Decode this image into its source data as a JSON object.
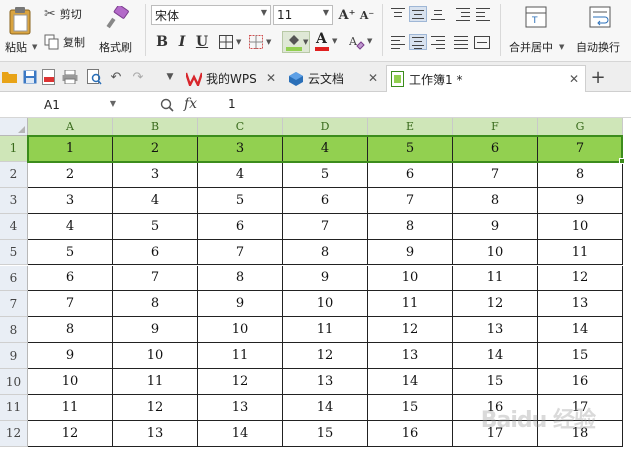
{
  "ribbon": {
    "paste_label": "粘贴",
    "cut_label": "剪切",
    "copy_label": "复制",
    "format_painter_label": "格式刷",
    "font_name": "宋体",
    "font_size": "11",
    "grow_font": "A⁺",
    "shrink_font": "A⁻",
    "bold": "B",
    "italic": "I",
    "underline": "U",
    "font_color_letter": "A",
    "merge_center_label": "合并居中",
    "wrap_text_label": "自动换行",
    "accent_green": "#92d050",
    "font_color_red": "#e02020"
  },
  "tabs": [
    {
      "label": "我的WPS",
      "icon": "wps-icon"
    },
    {
      "label": "云文档",
      "icon": "cloud-doc-icon"
    },
    {
      "label": "工作簿1 *",
      "icon": "workbook-icon",
      "active": true
    }
  ],
  "formula_bar": {
    "cell_ref": "A1",
    "fx": "fx",
    "value": "1"
  },
  "sheet": {
    "columns": [
      "A",
      "B",
      "C",
      "D",
      "E",
      "F",
      "G"
    ],
    "row_numbers": [
      "1",
      "2",
      "3",
      "4",
      "5",
      "6",
      "7",
      "8",
      "9",
      "10",
      "11",
      "12"
    ],
    "rows": [
      [
        "1",
        "2",
        "3",
        "4",
        "5",
        "6",
        "7"
      ],
      [
        "2",
        "3",
        "4",
        "5",
        "6",
        "7",
        "8"
      ],
      [
        "3",
        "4",
        "5",
        "6",
        "7",
        "8",
        "9"
      ],
      [
        "4",
        "5",
        "6",
        "7",
        "8",
        "9",
        "10"
      ],
      [
        "5",
        "6",
        "7",
        "8",
        "9",
        "10",
        "11"
      ],
      [
        "6",
        "7",
        "8",
        "9",
        "10",
        "11",
        "12"
      ],
      [
        "7",
        "8",
        "9",
        "10",
        "11",
        "12",
        "13"
      ],
      [
        "8",
        "9",
        "10",
        "11",
        "12",
        "13",
        "14"
      ],
      [
        "9",
        "10",
        "11",
        "12",
        "13",
        "14",
        "15"
      ],
      [
        "10",
        "11",
        "12",
        "13",
        "14",
        "15",
        "16"
      ],
      [
        "11",
        "12",
        "13",
        "14",
        "15",
        "16",
        "17"
      ],
      [
        "12",
        "13",
        "14",
        "15",
        "16",
        "17",
        "18"
      ]
    ],
    "selected_row": 1
  },
  "watermark": "Baidu 经验"
}
